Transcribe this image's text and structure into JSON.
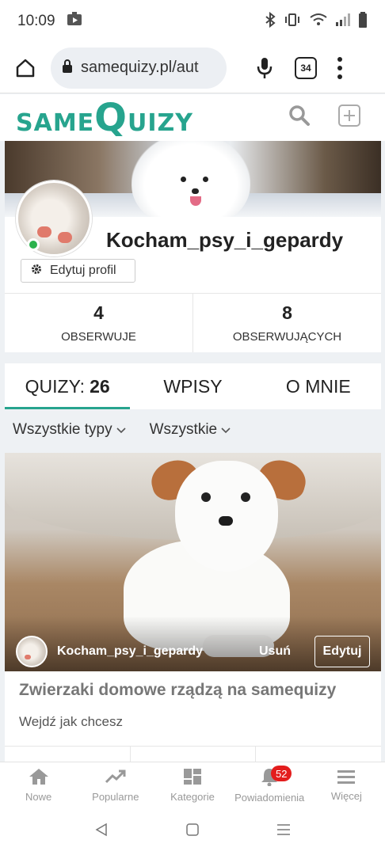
{
  "status_bar": {
    "time": "10:09"
  },
  "browser": {
    "url": "samequizy.pl/aut",
    "tab_count": "34"
  },
  "site": {
    "logo_small": "SAME",
    "logo_big": "Q",
    "logo_rest": "UIZY"
  },
  "profile": {
    "username": "Kocham_psy_i_gepardy",
    "edit_profile_label": "Edytuj profil",
    "following_count": "4",
    "following_label": "OBSERWUJE",
    "followers_count": "8",
    "followers_label": "OBSERWUJĄCYCH"
  },
  "tabs": [
    {
      "label": "QUIZY:",
      "count": "26"
    },
    {
      "label": "WPISY"
    },
    {
      "label": "O MNIE"
    }
  ],
  "filters": [
    {
      "label": "Wszystkie typy"
    },
    {
      "label": "Wszystkie"
    }
  ],
  "quiz": {
    "author": "Kocham_psy_i_gepardy",
    "remove_label": "Usuń",
    "edit_label": "Edytuj",
    "title": "Zwierzaki domowe rządzą na samequizy",
    "subtitle": "Wejdź jak chcesz"
  },
  "bottom_nav": [
    {
      "label": "Nowe",
      "icon": "home-icon"
    },
    {
      "label": "Popularne",
      "icon": "trending-icon"
    },
    {
      "label": "Kategorie",
      "icon": "grid-icon"
    },
    {
      "label": "Powiadomienia",
      "icon": "bell-icon",
      "badge": "52"
    },
    {
      "label": "Więcej",
      "icon": "menu-icon"
    }
  ],
  "colors": {
    "brand": "#27a48e",
    "badge": "#e31d1d"
  }
}
